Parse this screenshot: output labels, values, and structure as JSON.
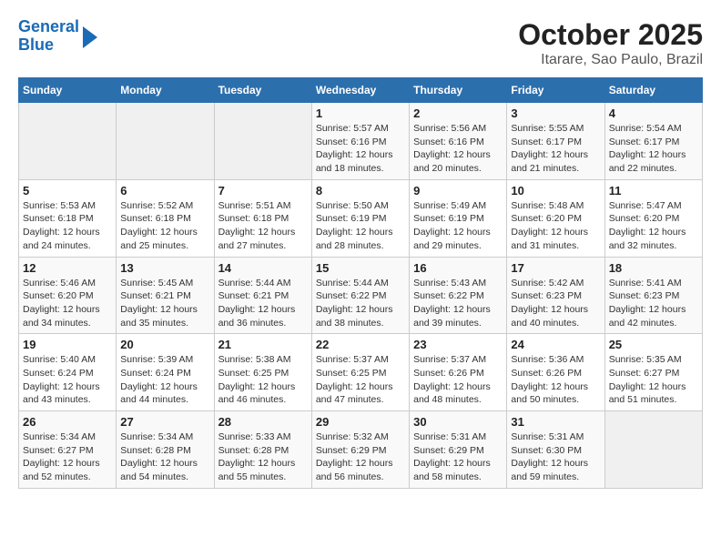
{
  "header": {
    "logo_line1": "General",
    "logo_line2": "Blue",
    "title": "October 2025",
    "subtitle": "Itarare, Sao Paulo, Brazil"
  },
  "weekdays": [
    "Sunday",
    "Monday",
    "Tuesday",
    "Wednesday",
    "Thursday",
    "Friday",
    "Saturday"
  ],
  "weeks": [
    [
      {
        "day": "",
        "info": ""
      },
      {
        "day": "",
        "info": ""
      },
      {
        "day": "",
        "info": ""
      },
      {
        "day": "1",
        "info": "Sunrise: 5:57 AM\nSunset: 6:16 PM\nDaylight: 12 hours and 18 minutes."
      },
      {
        "day": "2",
        "info": "Sunrise: 5:56 AM\nSunset: 6:16 PM\nDaylight: 12 hours and 20 minutes."
      },
      {
        "day": "3",
        "info": "Sunrise: 5:55 AM\nSunset: 6:17 PM\nDaylight: 12 hours and 21 minutes."
      },
      {
        "day": "4",
        "info": "Sunrise: 5:54 AM\nSunset: 6:17 PM\nDaylight: 12 hours and 22 minutes."
      }
    ],
    [
      {
        "day": "5",
        "info": "Sunrise: 5:53 AM\nSunset: 6:18 PM\nDaylight: 12 hours and 24 minutes."
      },
      {
        "day": "6",
        "info": "Sunrise: 5:52 AM\nSunset: 6:18 PM\nDaylight: 12 hours and 25 minutes."
      },
      {
        "day": "7",
        "info": "Sunrise: 5:51 AM\nSunset: 6:18 PM\nDaylight: 12 hours and 27 minutes."
      },
      {
        "day": "8",
        "info": "Sunrise: 5:50 AM\nSunset: 6:19 PM\nDaylight: 12 hours and 28 minutes."
      },
      {
        "day": "9",
        "info": "Sunrise: 5:49 AM\nSunset: 6:19 PM\nDaylight: 12 hours and 29 minutes."
      },
      {
        "day": "10",
        "info": "Sunrise: 5:48 AM\nSunset: 6:20 PM\nDaylight: 12 hours and 31 minutes."
      },
      {
        "day": "11",
        "info": "Sunrise: 5:47 AM\nSunset: 6:20 PM\nDaylight: 12 hours and 32 minutes."
      }
    ],
    [
      {
        "day": "12",
        "info": "Sunrise: 5:46 AM\nSunset: 6:20 PM\nDaylight: 12 hours and 34 minutes."
      },
      {
        "day": "13",
        "info": "Sunrise: 5:45 AM\nSunset: 6:21 PM\nDaylight: 12 hours and 35 minutes."
      },
      {
        "day": "14",
        "info": "Sunrise: 5:44 AM\nSunset: 6:21 PM\nDaylight: 12 hours and 36 minutes."
      },
      {
        "day": "15",
        "info": "Sunrise: 5:44 AM\nSunset: 6:22 PM\nDaylight: 12 hours and 38 minutes."
      },
      {
        "day": "16",
        "info": "Sunrise: 5:43 AM\nSunset: 6:22 PM\nDaylight: 12 hours and 39 minutes."
      },
      {
        "day": "17",
        "info": "Sunrise: 5:42 AM\nSunset: 6:23 PM\nDaylight: 12 hours and 40 minutes."
      },
      {
        "day": "18",
        "info": "Sunrise: 5:41 AM\nSunset: 6:23 PM\nDaylight: 12 hours and 42 minutes."
      }
    ],
    [
      {
        "day": "19",
        "info": "Sunrise: 5:40 AM\nSunset: 6:24 PM\nDaylight: 12 hours and 43 minutes."
      },
      {
        "day": "20",
        "info": "Sunrise: 5:39 AM\nSunset: 6:24 PM\nDaylight: 12 hours and 44 minutes."
      },
      {
        "day": "21",
        "info": "Sunrise: 5:38 AM\nSunset: 6:25 PM\nDaylight: 12 hours and 46 minutes."
      },
      {
        "day": "22",
        "info": "Sunrise: 5:37 AM\nSunset: 6:25 PM\nDaylight: 12 hours and 47 minutes."
      },
      {
        "day": "23",
        "info": "Sunrise: 5:37 AM\nSunset: 6:26 PM\nDaylight: 12 hours and 48 minutes."
      },
      {
        "day": "24",
        "info": "Sunrise: 5:36 AM\nSunset: 6:26 PM\nDaylight: 12 hours and 50 minutes."
      },
      {
        "day": "25",
        "info": "Sunrise: 5:35 AM\nSunset: 6:27 PM\nDaylight: 12 hours and 51 minutes."
      }
    ],
    [
      {
        "day": "26",
        "info": "Sunrise: 5:34 AM\nSunset: 6:27 PM\nDaylight: 12 hours and 52 minutes."
      },
      {
        "day": "27",
        "info": "Sunrise: 5:34 AM\nSunset: 6:28 PM\nDaylight: 12 hours and 54 minutes."
      },
      {
        "day": "28",
        "info": "Sunrise: 5:33 AM\nSunset: 6:28 PM\nDaylight: 12 hours and 55 minutes."
      },
      {
        "day": "29",
        "info": "Sunrise: 5:32 AM\nSunset: 6:29 PM\nDaylight: 12 hours and 56 minutes."
      },
      {
        "day": "30",
        "info": "Sunrise: 5:31 AM\nSunset: 6:29 PM\nDaylight: 12 hours and 58 minutes."
      },
      {
        "day": "31",
        "info": "Sunrise: 5:31 AM\nSunset: 6:30 PM\nDaylight: 12 hours and 59 minutes."
      },
      {
        "day": "",
        "info": ""
      }
    ]
  ]
}
